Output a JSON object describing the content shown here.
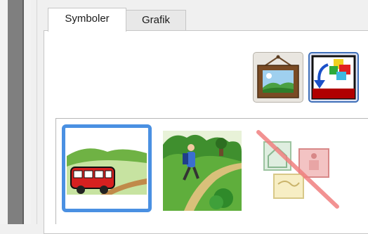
{
  "tabs": [
    {
      "label": "Symboler",
      "active": true
    },
    {
      "label": "Grafik",
      "active": false
    }
  ],
  "toolbar": {
    "buttons": [
      {
        "icon": "framed-picture-icon"
      },
      {
        "icon": "replace-symbol-icon"
      }
    ]
  },
  "symbols": [
    {
      "icon": "bus-landscape-icon",
      "selected": true
    },
    {
      "icon": "hiker-forest-icon",
      "selected": false
    },
    {
      "icon": "no-symbol-icon",
      "selected": false
    }
  ],
  "colors": {
    "selection_border": "#4a90e2",
    "active_button_border": "#3f6fb8",
    "left_bar": "#7f7f7f"
  }
}
